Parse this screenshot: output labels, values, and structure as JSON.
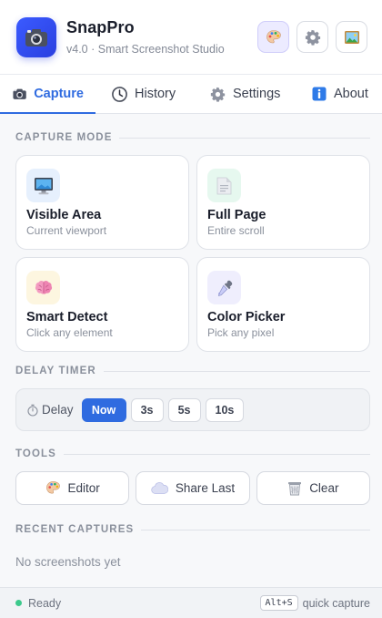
{
  "header": {
    "app_name": "SnapPro",
    "subtitle": "v4.0 · Smart Screenshot Studio",
    "logo_icon": "camera-icon",
    "buttons": [
      {
        "icon": "palette-icon",
        "active": true
      },
      {
        "icon": "gear-icon",
        "active": false
      },
      {
        "icon": "picture-icon",
        "active": false
      }
    ]
  },
  "tabs": [
    {
      "label": "Capture",
      "icon": "camera-icon",
      "active": true
    },
    {
      "label": "History",
      "icon": "clock-icon",
      "active": false
    },
    {
      "label": "Settings",
      "icon": "gear-icon",
      "active": false
    },
    {
      "label": "About",
      "icon": "info-icon",
      "active": false
    }
  ],
  "capture_mode": {
    "title": "CAPTURE MODE",
    "modes": [
      {
        "name": "Visible Area",
        "desc": "Current viewport",
        "icon": "monitor-icon"
      },
      {
        "name": "Full Page",
        "desc": "Entire scroll",
        "icon": "document-icon"
      },
      {
        "name": "Smart Detect",
        "desc": "Click any element",
        "icon": "brain-icon"
      },
      {
        "name": "Color Picker",
        "desc": "Pick any pixel",
        "icon": "eyedropper-icon"
      }
    ]
  },
  "delay": {
    "title": "DELAY TIMER",
    "label": "Delay",
    "icon": "stopwatch-icon",
    "options": [
      "Now",
      "3s",
      "5s",
      "10s"
    ],
    "selected": "Now"
  },
  "tools": {
    "title": "TOOLS",
    "buttons": [
      {
        "label": "Editor",
        "icon": "palette-icon"
      },
      {
        "label": "Share Last",
        "icon": "cloud-icon"
      },
      {
        "label": "Clear",
        "icon": "trash-icon"
      }
    ]
  },
  "recent": {
    "title": "RECENT CAPTURES",
    "empty_text": "No screenshots yet"
  },
  "status": {
    "text": "Ready",
    "shortcut": "Alt+S",
    "shortcut_label": "quick capture"
  },
  "colors": {
    "accent": "#2f6be0",
    "logo": "#3b5bff",
    "ready_dot": "#3cc98c"
  }
}
